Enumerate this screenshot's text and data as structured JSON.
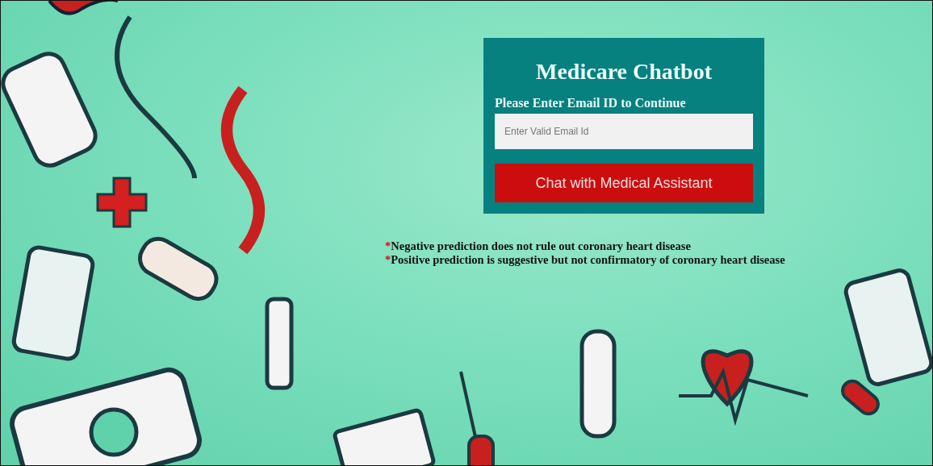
{
  "card": {
    "title": "Medicare Chatbot",
    "prompt": "Please Enter Email ID to Continue",
    "email_field": {
      "placeholder": "Enter Valid Email Id"
    },
    "button": "Chat with Medical Assistant"
  },
  "notes": [
    {
      "mark": "*",
      "text": "Negative prediction does not rule out coronary heart disease"
    },
    {
      "mark": "*",
      "text": "Positive prediction is suggestive but not confirmatory of coronary heart disease"
    }
  ]
}
